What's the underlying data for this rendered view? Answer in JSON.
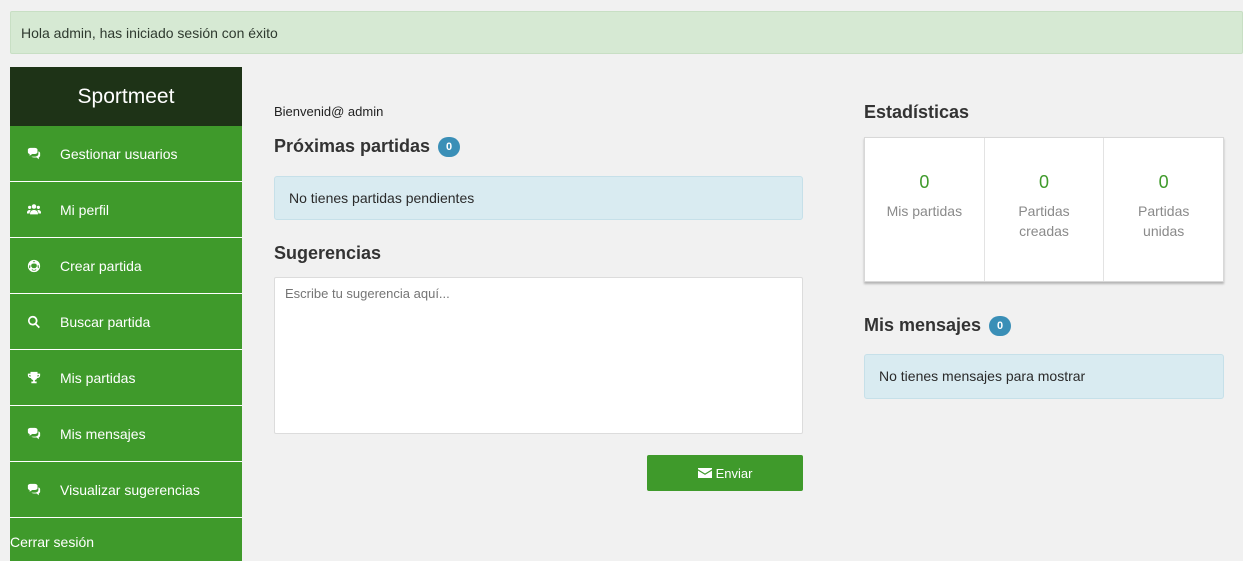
{
  "alert": "Hola admin, has iniciado sesión con éxito",
  "sidebar": {
    "brand": "Sportmeet",
    "items": [
      {
        "label": "Gestionar usuarios",
        "icon": "comments-icon"
      },
      {
        "label": "Mi perfil",
        "icon": "users-icon"
      },
      {
        "label": "Crear partida",
        "icon": "soccer-ball-icon"
      },
      {
        "label": "Buscar partida",
        "icon": "search-icon"
      },
      {
        "label": "Mis partidas",
        "icon": "trophy-icon"
      },
      {
        "label": "Mis mensajes",
        "icon": "comments-icon"
      },
      {
        "label": "Visualizar sugerencias",
        "icon": "comments-icon"
      }
    ],
    "logout": "Cerrar sesión"
  },
  "main": {
    "welcome": "Bienvenid@ admin",
    "proximas_title": "Próximas partidas",
    "proximas_count": "0",
    "pending_text": "No tienes partidas pendientes",
    "sugerencias_title": "Sugerencias",
    "textarea_placeholder": "Escribe tu sugerencia aquí...",
    "send_label": "Enviar"
  },
  "right": {
    "stats_title": "Estadísticas",
    "stats": [
      {
        "value": "0",
        "label": "Mis partidas"
      },
      {
        "value": "0",
        "label": "Partidas creadas"
      },
      {
        "value": "0",
        "label": "Partidas unidas"
      }
    ],
    "messages_title": "Mis mensajes",
    "messages_count": "0",
    "messages_text": "No tienes mensajes para mostrar"
  },
  "colors": {
    "accent": "#3f9a2b",
    "brand_bg": "#1e3317",
    "alert_bg": "#d6e9d3",
    "info_bg": "#d9ebf1",
    "badge": "#3a8fb7"
  }
}
